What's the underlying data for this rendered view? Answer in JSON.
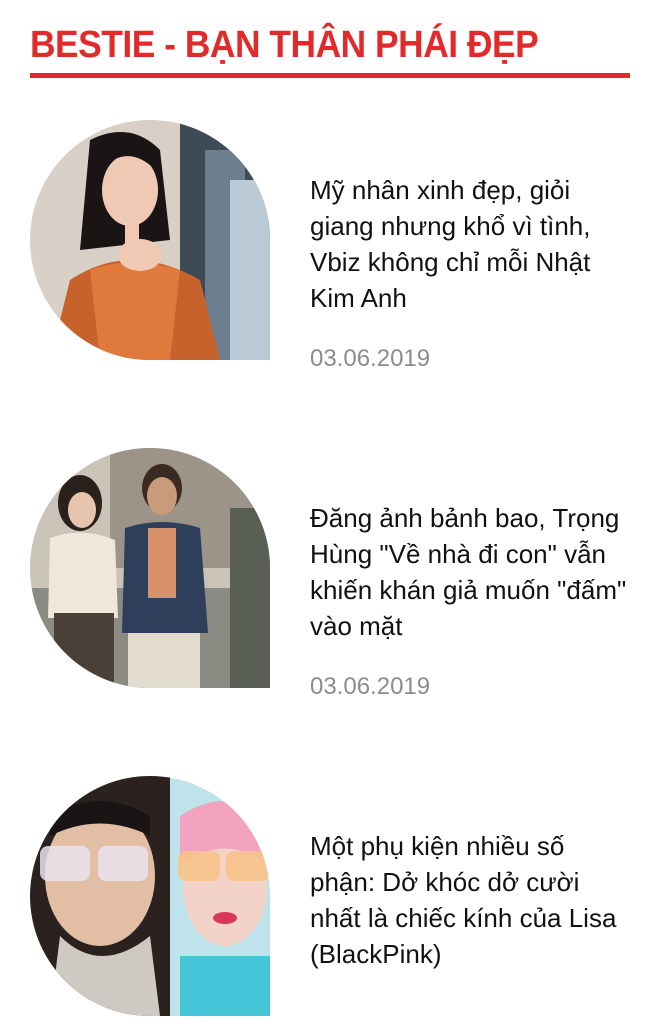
{
  "section": {
    "title": "BESTIE - BẠN THÂN PHÁI ĐẸP",
    "accent_color": "#e12b2b"
  },
  "articles": [
    {
      "title": "Mỹ nhân xinh đẹp, giỏi giang nhưng khổ vì tình, Vbiz không chỉ mỗi Nhật Kim Anh",
      "date": "03.06.2019",
      "thumbnail": "woman-in-orange-dress-photo"
    },
    {
      "title": "Đăng ảnh bảnh bao, Trọng Hùng \"Về nhà đi con\" vẫn khiến khán giả muốn \"đấm\" vào mặt",
      "date": "03.06.2019",
      "thumbnail": "couple-standing-outdoors-photo"
    },
    {
      "title": "Một phụ kiện nhiều số phận: Dở khóc dở cười nhất là chiếc kính của Lisa (BlackPink)",
      "date": "",
      "thumbnail": "two-women-jeweled-glasses-photo"
    }
  ],
  "colors": {
    "title_text": "#111111",
    "date_text": "#8c8c8c"
  }
}
